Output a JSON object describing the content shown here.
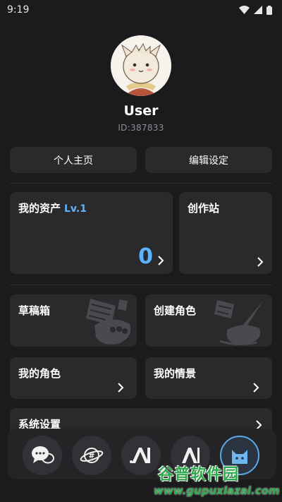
{
  "status_bar": {
    "time": "9:19"
  },
  "profile": {
    "username": "User",
    "user_id": "ID:387833"
  },
  "actions": {
    "home_label": "个人主页",
    "settings_label": "编辑设定"
  },
  "assets": {
    "title": "我的资产",
    "level": "Lv.1",
    "value": "0"
  },
  "studio": {
    "title": "创作站"
  },
  "drafts": {
    "title": "草稿箱"
  },
  "create_character": {
    "title": "创建角色"
  },
  "my_characters": {
    "title": "我的角色"
  },
  "my_scenes": {
    "title": "我的情景"
  },
  "system_settings": {
    "title": "系统设置"
  },
  "bottom_nav": {
    "items": [
      {
        "icon": "chat-bubbles-icon"
      },
      {
        "icon": "planet-hashtag-icon"
      },
      {
        "icon": "ai-icon"
      },
      {
        "icon": "ai-outline-icon"
      },
      {
        "icon": "cat-profile-icon"
      }
    ]
  },
  "watermark": {
    "title": "谷普软件园",
    "url": "www.gupuxlazai.com"
  },
  "colors": {
    "accent": "#5db2ff",
    "card": "#2a2a2d",
    "background": "#1b1b1d"
  }
}
